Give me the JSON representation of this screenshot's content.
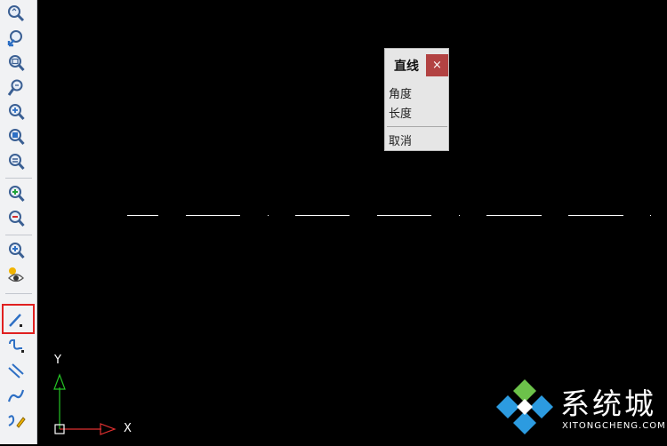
{
  "toolbar": {
    "buttons": [
      {
        "icon": "zoom-realtime-icon"
      },
      {
        "icon": "zoom-previous-icon"
      },
      {
        "icon": "zoom-window-icon"
      },
      {
        "icon": "zoom-dynamic-icon"
      },
      {
        "icon": "zoom-scale-icon"
      },
      {
        "icon": "zoom-center-icon"
      },
      {
        "icon": "zoom-object-icon"
      },
      {
        "icon": "zoom-in-icon"
      },
      {
        "icon": "zoom-out-icon"
      },
      {
        "icon": "zoom-all-icon"
      },
      {
        "icon": "render-view-icon"
      },
      {
        "icon": "line-tool-icon",
        "selected": true
      },
      {
        "icon": "polyline-icon"
      },
      {
        "icon": "double-line-icon"
      },
      {
        "icon": "spline-icon"
      },
      {
        "icon": "freehand-sketch-icon"
      }
    ]
  },
  "popup": {
    "title": "直线",
    "close": "×",
    "items": [
      "角度",
      "长度"
    ],
    "cancel": "取消"
  },
  "ucs": {
    "x_label": "X",
    "y_label": "Y"
  },
  "watermark": {
    "brand": "系统城",
    "url": "XITONGCHENG.COM"
  },
  "colors": {
    "canvas": "#000000",
    "accent_red": "#e02020",
    "close_button": "#b24242"
  }
}
